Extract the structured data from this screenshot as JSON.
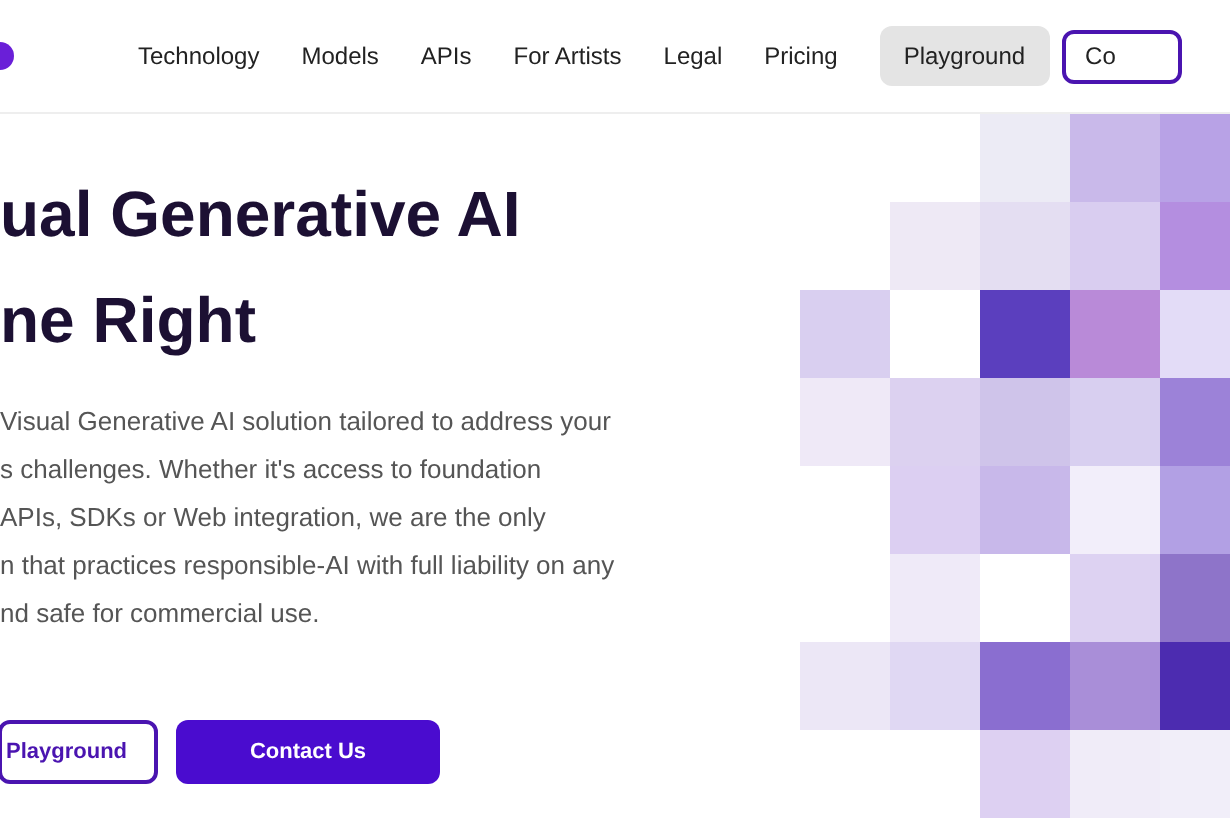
{
  "nav": {
    "links": [
      {
        "label": "Technology",
        "selected": false
      },
      {
        "label": "Models",
        "selected": false
      },
      {
        "label": "APIs",
        "selected": false
      },
      {
        "label": "For Artists",
        "selected": false
      },
      {
        "label": "Legal",
        "selected": false
      },
      {
        "label": "Pricing",
        "selected": false
      },
      {
        "label": "Playground",
        "selected": true
      }
    ],
    "cta": "Co"
  },
  "hero": {
    "headline": [
      "ual Generative AI",
      "ne Right"
    ],
    "paragraph": [
      "Visual Generative AI solution tailored to address your",
      "s challenges. Whether it's access to foundation",
      "APIs, SDKs or Web integration, we are the only",
      "n that practices responsible-AI with full liability on any",
      "nd safe for commercial use."
    ],
    "buttons": [
      {
        "label": "Playground",
        "kind": "outline"
      },
      {
        "label": "Contact Us",
        "kind": "filled"
      }
    ]
  }
}
